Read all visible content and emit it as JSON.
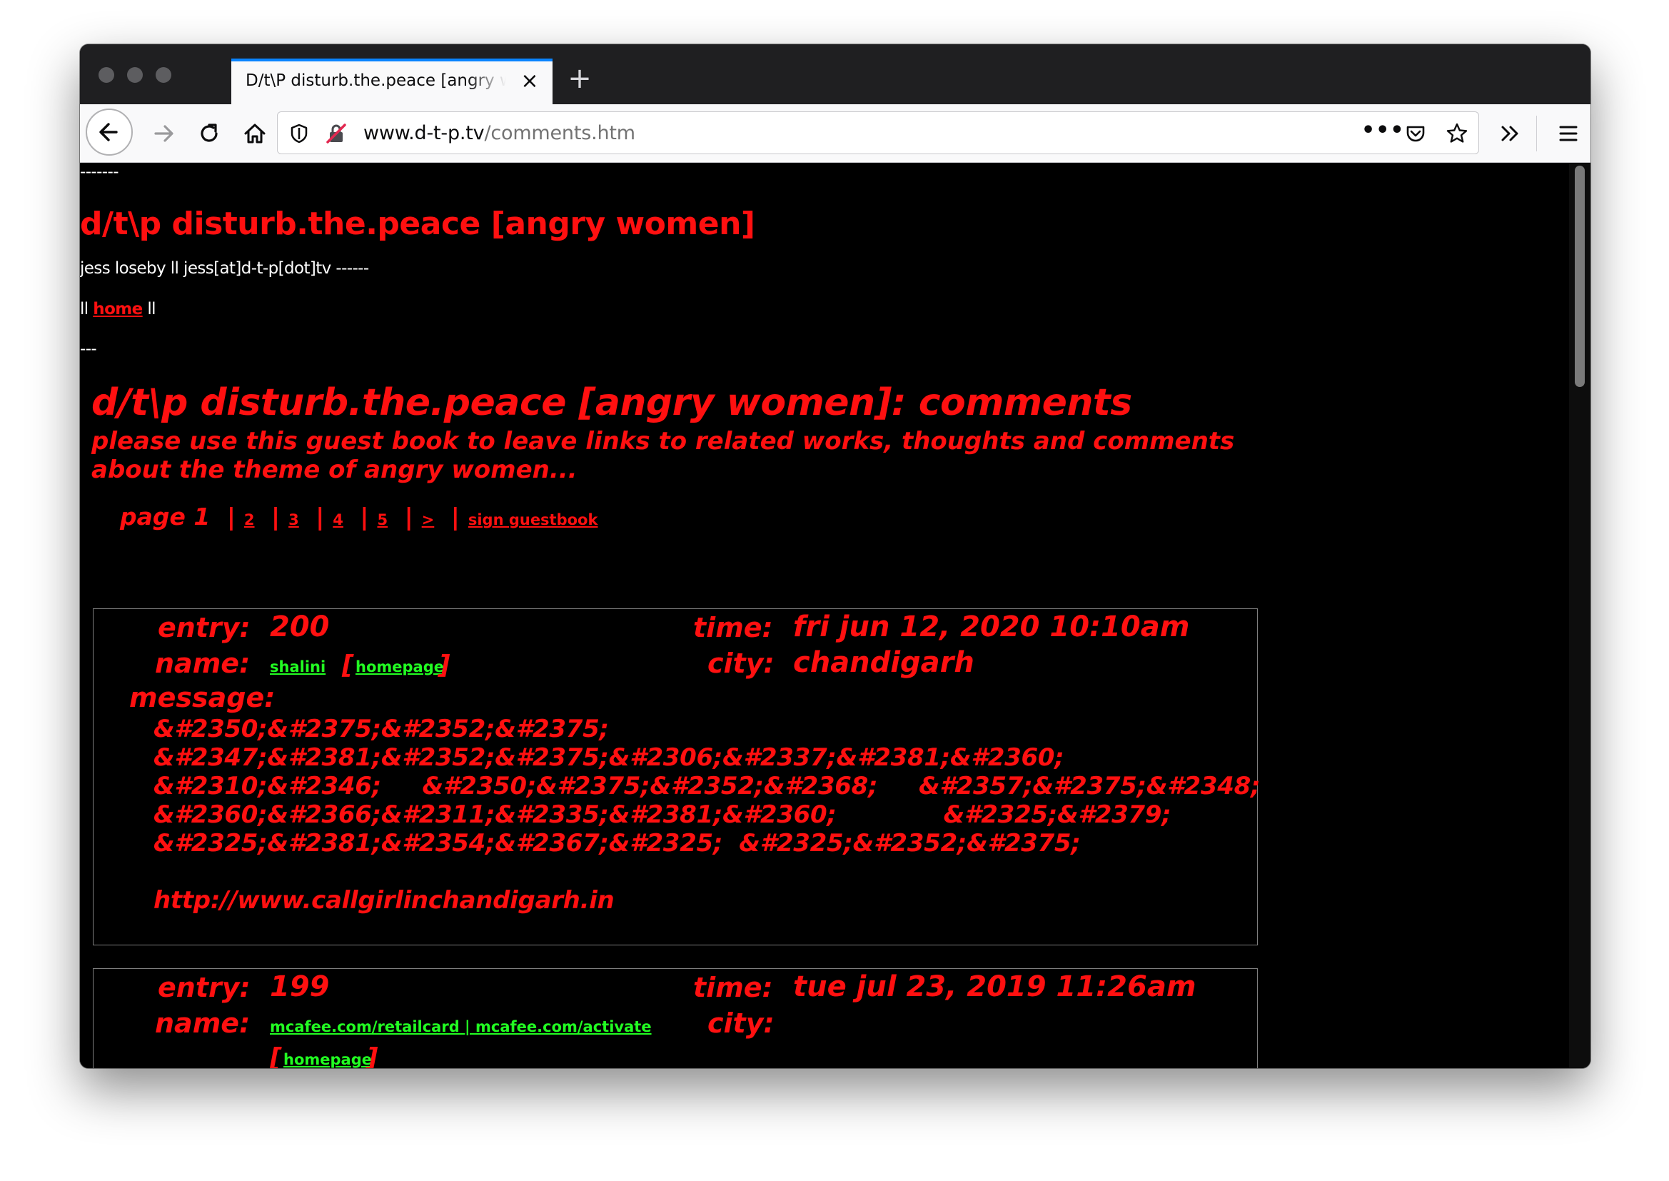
{
  "browser": {
    "tab_title": "D/t\\P disturb.the.peace [angry women]",
    "url_host": "www.d-t-p.tv",
    "url_path": "/comments.htm",
    "accent_color": "#0a84ff"
  },
  "page": {
    "top_dashes": "-------",
    "site_title": "d/t\\p disturb.the.peace [angry women]",
    "byline": "jess loseby ll jess[at]d-t-p[dot]tv ------",
    "nav_prefix": "ll ",
    "nav_home": "home",
    "nav_suffix": " ll",
    "divider": "---",
    "comments_heading": "d/t\\p disturb.the.peace [angry women]: comments",
    "intro": "please use this guest book to leave links to related works, thoughts and comments about the theme of angry women...",
    "pager": {
      "current": "page 1",
      "pages": [
        "2",
        "3",
        "4",
        "5",
        ">"
      ],
      "sign": "sign guestbook"
    },
    "labels": {
      "entry": "entry:",
      "time": "time:",
      "name": "name:",
      "city": "city:",
      "message": "message:",
      "bracket_open": "[",
      "bracket_close": "]"
    },
    "entries": [
      {
        "number": "200",
        "time": "fri jun 12, 2020 10:10am",
        "name": "shalini",
        "homepage": "homepage",
        "city": "chandigarh",
        "message_lines": [
          "&#2350;&#2375;&#2352;&#2375;",
          "&#2347;&#2381;&#2352;&#2375;&#2306;&#2337;&#2381;&#2360;",
          "&#2310;&#2346;     &#2350;&#2375;&#2352;&#2368;     &#2357;&#2375;&#2348;",
          "&#2360;&#2366;&#2311;&#2335;&#2381;&#2360;             &#2325;&#2379;",
          "&#2325;&#2381;&#2354;&#2367;&#2325;  &#2325;&#2352;&#2375;",
          "",
          "http://www.callgirlinchandigarh.in"
        ]
      },
      {
        "number": "199",
        "time": "tue jul 23, 2019 11:26am",
        "name": "mcafee.com/retailcard | mcafee.com/activate",
        "homepage": "homepage",
        "city": ""
      }
    ]
  }
}
